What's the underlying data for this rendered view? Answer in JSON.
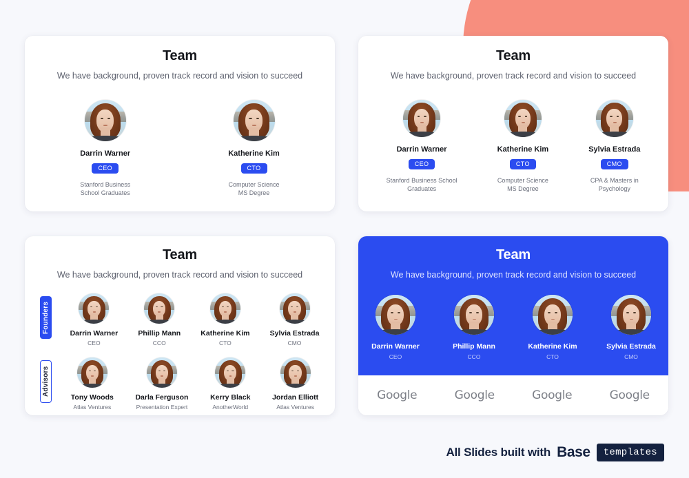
{
  "colors": {
    "page_background": "#f7f8fc",
    "accent_blue": "#2b4cf0",
    "coral": "#f78e7e",
    "navy": "#14213f",
    "card_white": "#ffffff"
  },
  "decor": {
    "blob_name": "coral-blob"
  },
  "cards": [
    {
      "id": "card-team-two",
      "title": "Team",
      "subtitle": "We have background, proven track record and vision to succeed",
      "members": [
        {
          "name": "Darrin Warner",
          "badge": "CEO",
          "desc_line1": "Stanford Business",
          "desc_line2": "School Graduates"
        },
        {
          "name": "Katherine Kim",
          "badge": "CTO",
          "desc_line1": "Computer Science",
          "desc_line2": "MS Degree"
        }
      ]
    },
    {
      "id": "card-team-three",
      "title": "Team",
      "subtitle": "We have background, proven track record and vision to succeed",
      "members": [
        {
          "name": "Darrin Warner",
          "badge": "CEO",
          "desc_line1": "Stanford Business School",
          "desc_line2": "Graduates"
        },
        {
          "name": "Katherine Kim",
          "badge": "CTO",
          "desc_line1": "Computer Science",
          "desc_line2": "MS Degree"
        },
        {
          "name": "Sylvia Estrada",
          "badge": "CMO",
          "desc_line1": "CPA & Masters in",
          "desc_line2": "Psychology"
        }
      ]
    },
    {
      "id": "card-team-groups",
      "title": "Team",
      "subtitle": "We have background, proven track record and vision to succeed",
      "groups": [
        {
          "label": "Founders",
          "style": "filled",
          "members": [
            {
              "name": "Darrin Warner",
              "role": "CEO"
            },
            {
              "name": "Phillip Mann",
              "role": "CCO"
            },
            {
              "name": "Katherine Kim",
              "role": "CTO"
            },
            {
              "name": "Sylvia Estrada",
              "role": "CMO"
            }
          ]
        },
        {
          "label": "Advisors",
          "style": "outline",
          "members": [
            {
              "name": "Tony Woods",
              "role": "Atlas Ventures"
            },
            {
              "name": "Darla Ferguson",
              "role": "Presentation Expert"
            },
            {
              "name": "Kerry Black",
              "role": "AnotherWorld"
            },
            {
              "name": "Jordan Elliott",
              "role": "Atlas Ventures"
            }
          ]
        }
      ]
    },
    {
      "id": "card-team-blue",
      "title": "Team",
      "subtitle": "We have background, proven track record and vision to succeed",
      "members": [
        {
          "name": "Darrin Warner",
          "role": "CEO",
          "logo": "Google"
        },
        {
          "name": "Phillip Mann",
          "role": "CCO",
          "logo": "Google"
        },
        {
          "name": "Katherine Kim",
          "role": "CTO",
          "logo": "Google"
        },
        {
          "name": "Sylvia Estrada",
          "role": "CMO",
          "logo": "Google"
        }
      ]
    }
  ],
  "footer": {
    "text": "All Slides built with",
    "brand": "Base",
    "badge": "templates"
  }
}
